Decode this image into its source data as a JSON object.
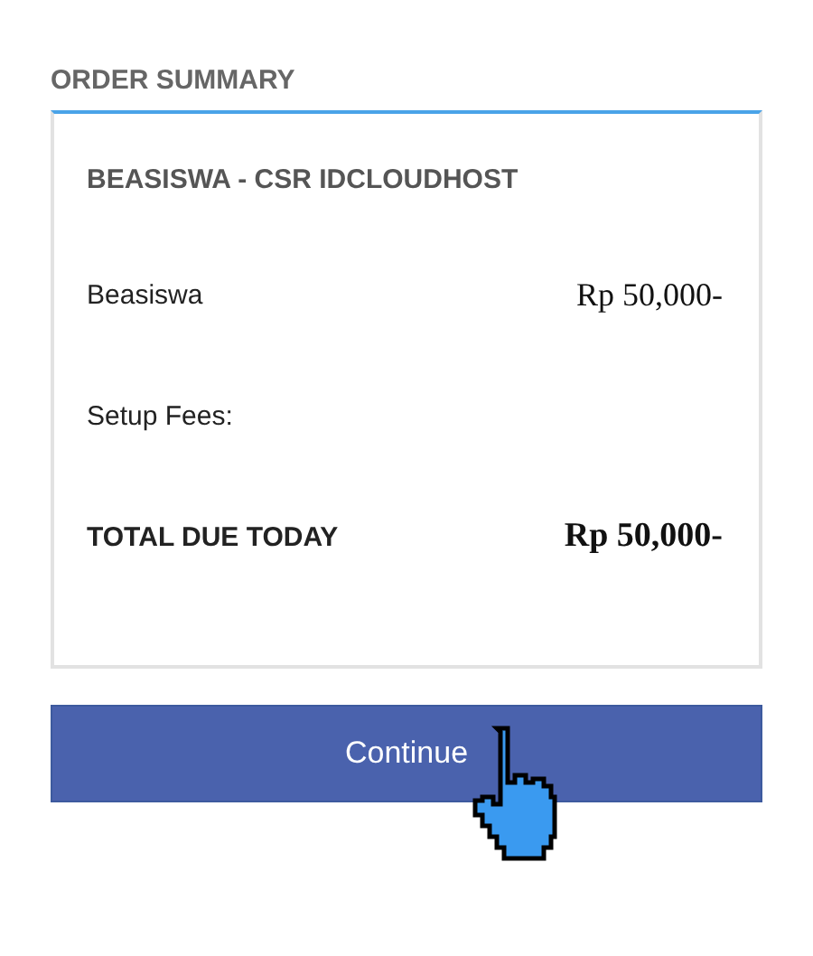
{
  "heading": "ORDER SUMMARY",
  "product": "BEASISWA - CSR IDCLOUDHOST",
  "lines": [
    {
      "kind": "item",
      "label": "Beasiswa",
      "amount": "Rp 50,000-"
    },
    {
      "kind": "item",
      "label": "Setup Fees:"
    },
    {
      "kind": "total",
      "label": "TOTAL DUE TODAY",
      "amount": "Rp 50,000-"
    }
  ],
  "button": "Continue"
}
